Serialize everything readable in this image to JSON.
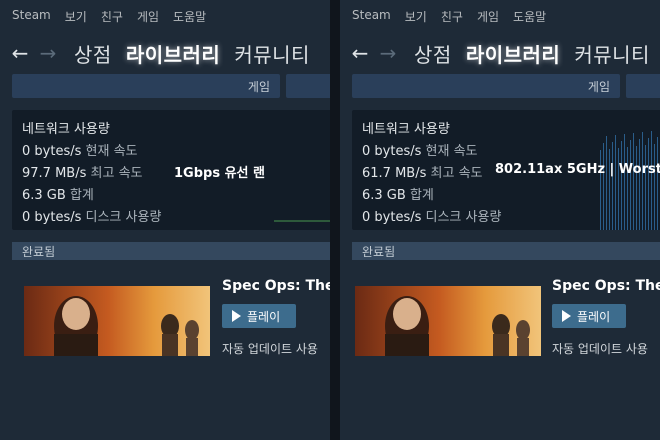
{
  "menu": [
    "Steam",
    "보기",
    "친구",
    "게임",
    "도움말"
  ],
  "nav": {
    "store": "상점",
    "library": "라이브러리",
    "community": "커뮤니티"
  },
  "subbar": {
    "games_label": "게임"
  },
  "network": {
    "title": "네트워크 사용량",
    "current_label": "현재 속도",
    "max_label": "최고 속도",
    "total_label": "합계",
    "disk_label": "디스크 사용량"
  },
  "panels": [
    {
      "current_value": "0 bytes/s",
      "max_value": "97.7 MB/s",
      "total_value": "6.3 GB",
      "disk_value": "0 bytes/s",
      "caption": "1Gbps 유선 랜"
    },
    {
      "current_value": "0 bytes/s",
      "max_value": "61.7 MB/s",
      "total_value": "6.3 GB",
      "disk_value": "0 bytes/s",
      "caption": "802.11ax 5GHz | Worst"
    }
  ],
  "section": {
    "completed": "완료됨"
  },
  "game": {
    "title": "Spec Ops: The",
    "play": "플레이",
    "auto_update": "자동 업데이트 사용"
  },
  "colors": {
    "bg": "#1e2a37",
    "play_button": "#3d6c8d",
    "section_header": "#34485e"
  },
  "icons": {
    "back": "arrow-left-icon",
    "forward": "arrow-right-icon",
    "play": "play-icon"
  }
}
